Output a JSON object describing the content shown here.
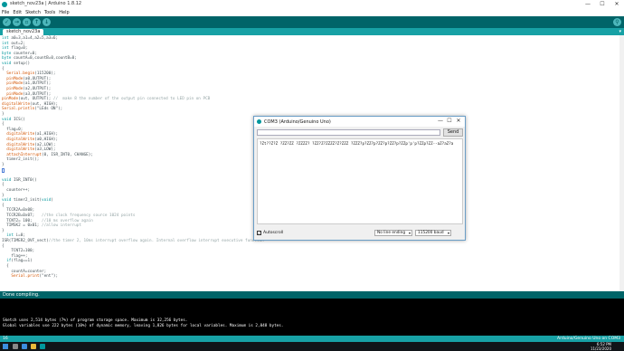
{
  "window": {
    "title": "sketch_nov23a | Arduino 1.8.12",
    "controls": [
      "—",
      "☐",
      "✕"
    ]
  },
  "menu": [
    "File",
    "Edit",
    "Sketch",
    "Tools",
    "Help"
  ],
  "toolbar": {
    "buttons": [
      {
        "icon": "verify-icon",
        "glyph": "✓"
      },
      {
        "icon": "upload-icon",
        "glyph": "→"
      },
      {
        "icon": "new-icon",
        "glyph": "▫"
      },
      {
        "icon": "open-icon",
        "glyph": "↑"
      },
      {
        "icon": "save-icon",
        "glyph": "↓"
      }
    ],
    "serial_monitor_glyph": "⚲"
  },
  "tab": {
    "label": "sketch_nov23a",
    "menu_glyph": "▾"
  },
  "code": [
    "int a0=3,a1=4,a2=5,a3=6;",
    "int out=2;",
    "int flag=0;",
    "byte counter=0;",
    "byte countA=0,countB=0,countB=0;",
    "void setup()",
    "{",
    "  Serial.begin(115200);",
    "  pinMode(a0,OUTPUT);",
    "  pinMode(a1,OUTPUT);",
    "  pinMode(a2,OUTPUT);",
    "  pinMode(a3,OUTPUT);",
    "pinMode(out, OUTPUT); //  make 8 the number of the output pin connected to LED pin on PCB",
    "digitalWrite(out, HIGH);",
    "Serial.println(\"LEds ON\");",
    "}",
    "void ICS()",
    "{",
    "  flag=0;",
    "  digitalWrite(a1,HIGH);",
    "  digitalWrite(a0,HIGH);",
    "  digitalWrite(a2,LOW);",
    "  digitalWrite(a3,LOW);",
    "  attachInterrupt(0, ISR_INT0, CHANGE);",
    "  timer2_init();",
    "}",
    "",
    "",
    "void ISR_INT0()",
    "{",
    "  counter++;",
    "}",
    "void timer2_init(void)",
    "{",
    "  TCCR2A=0x00;",
    "  TCCR2B=0x07;   //the clock frequency source 1024 points",
    "  TCNT2= 100;    //10 ms overflow again",
    "  TIMSK2 = 0x01; //allow interrupt",
    "}",
    "  int i=0;",
    "ISR(TIMER2_OVF_vect)//the timer 2, 10ms interrupt overflow again. Internal overflow interrupt executive function",
    "{",
    "    TCNT2=100;",
    "    flag++;",
    "  if(flag==1)",
    "  {",
    "    countA=counter;",
    "    Serial.print(\"ent\");"
  ],
  "status": "Done compiling.",
  "console": [
    "Sketch uses 2,514 bytes (7%) of program storage space. Maximum is 32,256 bytes.",
    "Global variables use 222 bytes (10%) of dynamic memory, leaving 1,826 bytes for local variables. Maximum is 2,048 bytes."
  ],
  "footer": {
    "line": "16",
    "board": "Arduino/Genuino Uno on COM3"
  },
  "serial_monitor": {
    "title": "COM3 (Arduino/Genuino Uno)",
    "send_label": "Send",
    "output": "?Zt??Z?Z  ?ZZ?ZZ  ?ZZZZ?  ?ZZ?Z?ZZZZ?Z?ZZZ  ?ZZZ?p?ZZ?p?ZZ?p?ZZ?p?ZZp'p'p?ZZp?ZZ--aZ?aZ?a",
    "autoscroll_label": "Autoscroll",
    "line_ending": "No line ending",
    "baud": "115200 baud"
  },
  "taskbar": {
    "time": "6:52 PM",
    "date": "11/23/2020"
  }
}
